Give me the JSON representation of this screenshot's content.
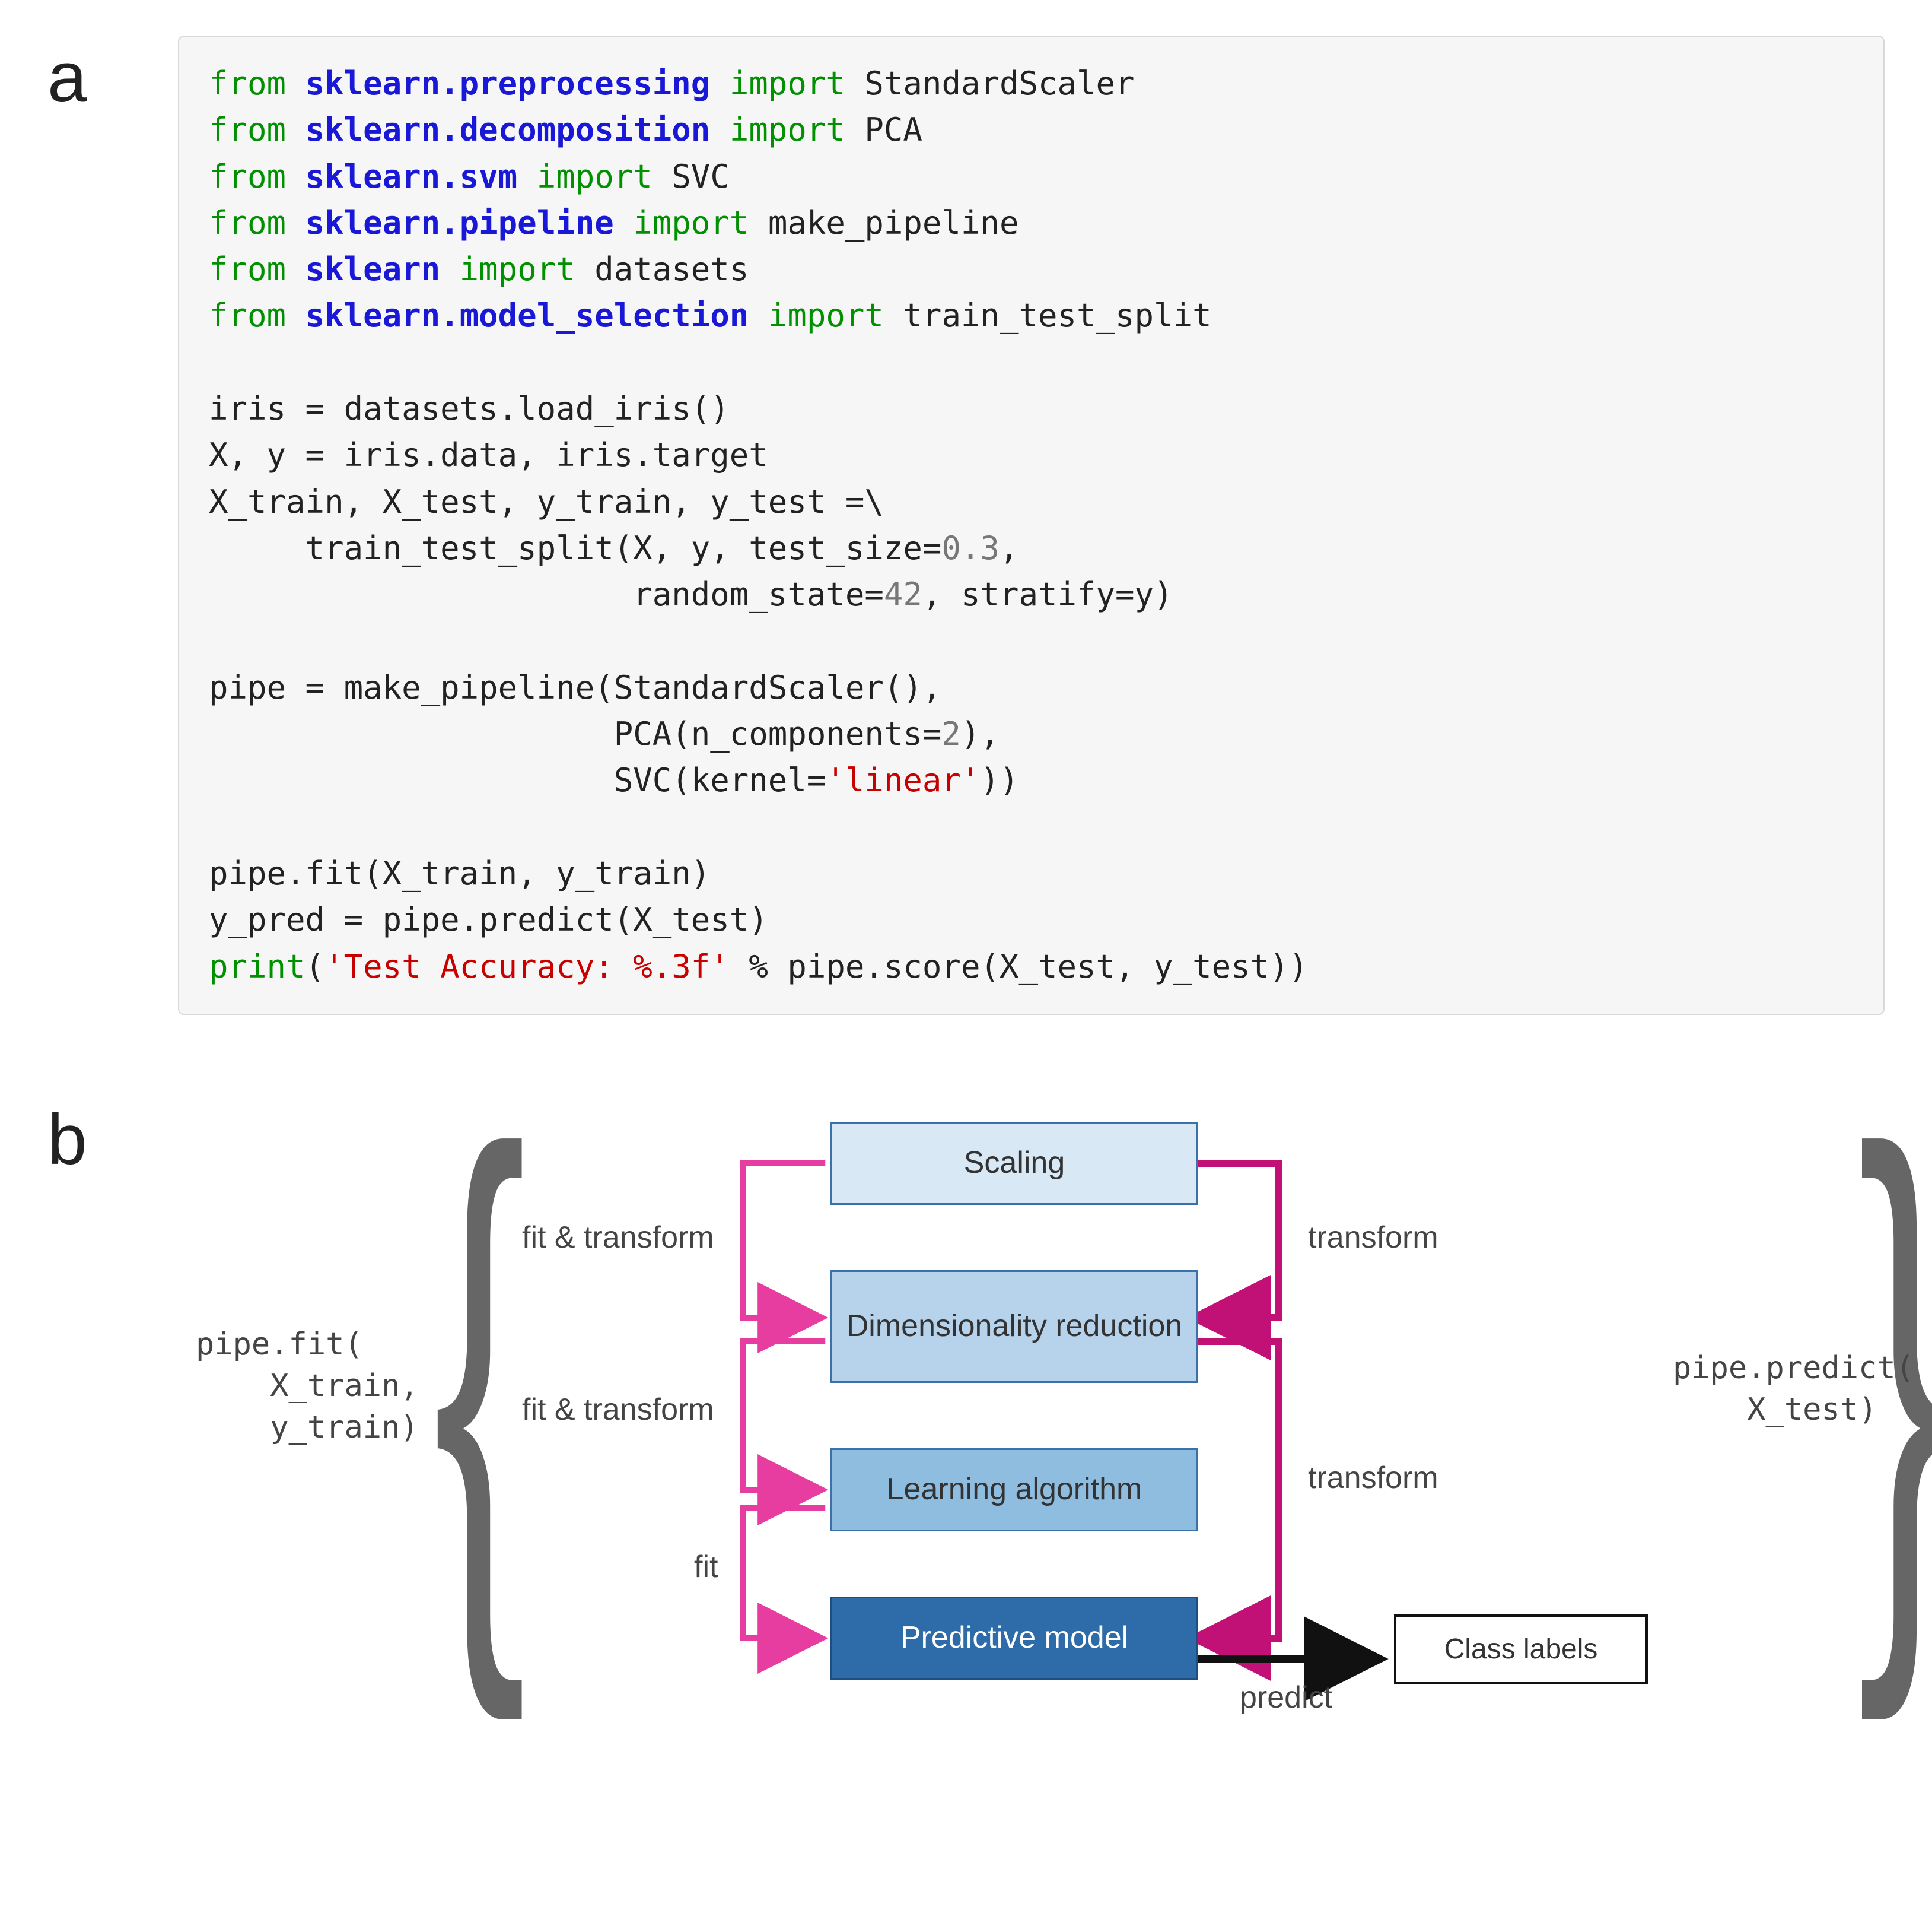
{
  "labels": {
    "a": "a",
    "b": "b"
  },
  "code": {
    "l1": {
      "kw1": "from",
      "mod": "sklearn.preprocessing",
      "kw2": "import",
      "rest": " StandardScaler"
    },
    "l2": {
      "kw1": "from",
      "mod": "sklearn.decomposition",
      "kw2": "import",
      "rest": " PCA"
    },
    "l3": {
      "kw1": "from",
      "mod": "sklearn.svm",
      "kw2": "import",
      "rest": " SVC"
    },
    "l4": {
      "kw1": "from",
      "mod": "sklearn.pipeline",
      "kw2": "import",
      "rest": " make_pipeline"
    },
    "l5": {
      "kw1": "from",
      "mod": "sklearn",
      "kw2": "import",
      "rest": " datasets"
    },
    "l6": {
      "kw1": "from",
      "mod": "sklearn.model_selection",
      "kw2": "import",
      "rest": " train_test_split"
    },
    "blank": " ",
    "l8": "iris = datasets.load_iris()",
    "l9": "X, y = iris.data, iris.target",
    "l10a": "X_train, X_test, y_train, y_test =\\",
    "l10b_pre": "     train_test_split(X, y, test_size=",
    "l10b_num": "0.3",
    "l10b_post": ",",
    "l10c_pre": "                      random_state=",
    "l10c_num": "42",
    "l10c_mid": ", stratify=y)",
    "l12": "pipe = make_pipeline(StandardScaler(),",
    "l13_pre": "                     PCA(n_components=",
    "l13_num": "2",
    "l13_post": "),",
    "l14_pre": "                     SVC(kernel=",
    "l14_str": "'linear'",
    "l14_post": "))",
    "l16": "pipe.fit(X_train, y_train)",
    "l17": "y_pred = pipe.predict(X_test)",
    "l18_kw": "print",
    "l18_open": "(",
    "l18_str": "'Test Accuracy: %.3f'",
    "l18_rest": " % pipe.score(X_test, y_test))"
  },
  "diagram": {
    "stages": {
      "scaling": "Scaling",
      "dimred": "Dimensionality reduction",
      "learn": "Learning algorithm",
      "model": "Predictive model"
    },
    "edges": {
      "fit_transform": "fit & transform",
      "fit": "fit",
      "transform": "transform",
      "predict": "predict"
    },
    "output": "Class labels",
    "left_call": "pipe.fit(\n    X_train,\n    y_train)",
    "right_call": "pipe.predict(\n    X_test)"
  }
}
